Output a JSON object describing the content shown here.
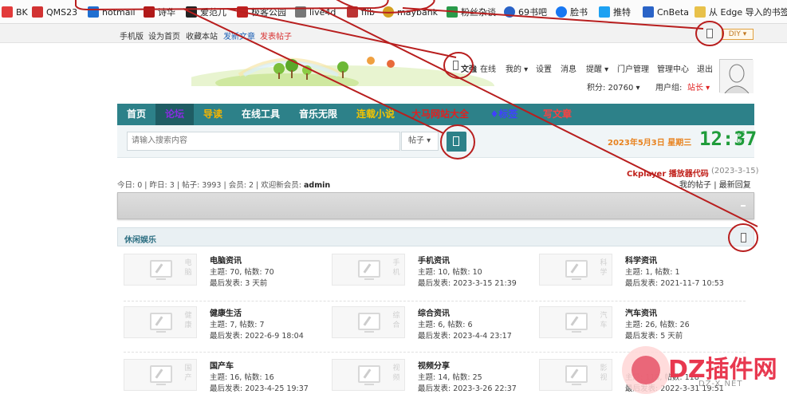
{
  "bookmarks": [
    {
      "label": "BK",
      "color": "#e23a3a"
    },
    {
      "label": "QMS23",
      "color": "#d23232"
    },
    {
      "label": "hotmail",
      "color": "#1f6fd1"
    },
    {
      "label": "诗华",
      "color": "#b01818"
    },
    {
      "label": "爱范儿",
      "color": "#222222"
    },
    {
      "label": "极客公园",
      "color": "#c02020"
    },
    {
      "label": "live4d",
      "color": "#777777"
    },
    {
      "label": "flib",
      "color": "#bb3333"
    },
    {
      "label": "maybank",
      "color": "#d4a020"
    },
    {
      "label": "粉丝杂谈",
      "color": "#2a9a4a"
    },
    {
      "label": "69书吧",
      "color": "#2a63c7"
    },
    {
      "label": "脸书",
      "color": "#1877f2"
    },
    {
      "label": "推特",
      "color": "#1da1f2"
    },
    {
      "label": "CnBeta",
      "color": "#2a63c7"
    },
    {
      "label": "从 Edge 导入的书签",
      "color": "#e8c14a"
    }
  ],
  "top_links": {
    "mobile": "手机版",
    "set_home": "设为首页",
    "favorite": "收藏本站",
    "new_post": "发新文章",
    "new_thread": "发表帖子",
    "diy": "DIY"
  },
  "user": {
    "name": "文強",
    "online": "在线",
    "mine": "我的",
    "settings": "设置",
    "messages": "消息",
    "remind": "提醒",
    "portal": "门户管理",
    "admin": "管理中心",
    "logout": "退出",
    "points_label": "积分: 20760",
    "group_label": "用户组:",
    "group": "站长"
  },
  "nav": [
    {
      "label": "首页",
      "color": "#ffffff"
    },
    {
      "label": "论坛",
      "color": "#8a2be2"
    },
    {
      "label": "导读",
      "color": "#f5b400"
    },
    {
      "label": "在线工具",
      "color": "#ffffff"
    },
    {
      "label": "音乐无限",
      "color": "#ffffff"
    },
    {
      "label": "连载小说",
      "color": "#f5c400"
    },
    {
      "label": "大马网站大全",
      "color": "#e02020"
    },
    {
      "label": "标签",
      "color": "#4040ff"
    },
    {
      "label": "写文章",
      "color": "#ff4040"
    }
  ],
  "search": {
    "placeholder": "请输入搜索内容",
    "type": "帖子"
  },
  "datetime": {
    "date": "2023年5月3日 星期三",
    "time": "12:37",
    "small_top": "08",
    "small_bottom": "07"
  },
  "stats": {
    "today_label": "今日:",
    "today": "0",
    "yesterday_label": "昨日:",
    "yesterday": "3",
    "posts_label": "帖子:",
    "posts": "3993",
    "members_label": "会员:",
    "members": "2",
    "welcome_label": "欢迎新会员:",
    "newest": "admin"
  },
  "notice": {
    "title": "Ckplayer 播放器代码",
    "date": "(2023-3-15)",
    "my_posts": "我的帖子",
    "latest": "最新回复"
  },
  "section": {
    "title": "休闲娱乐"
  },
  "forums": [
    {
      "name": "电脑资讯",
      "stats": "主题: 70, 帖数: 70",
      "last": "最后发表: 3 天前",
      "deco": "电脑"
    },
    {
      "name": "手机资讯",
      "stats": "主题: 10, 帖数: 10",
      "last": "最后发表: 2023-3-15 21:39",
      "deco": "手机"
    },
    {
      "name": "科学资讯",
      "stats": "主题: 1, 帖数: 1",
      "last": "最后发表: 2021-11-7 10:53",
      "deco": "科学"
    },
    {
      "name": "健康生活",
      "stats": "主题: 7, 帖数: 7",
      "last": "最后发表: 2022-6-9 18:04",
      "deco": "健康"
    },
    {
      "name": "综合资讯",
      "stats": "主题: 6, 帖数: 6",
      "last": "最后发表: 2023-4-4 23:17",
      "deco": "综合"
    },
    {
      "name": "汽车资讯",
      "stats": "主题: 26, 帖数: 26",
      "last": "最后发表: 5 天前",
      "deco": "汽车"
    },
    {
      "name": "国产车",
      "stats": "主题: 16, 帖数: 16",
      "last": "最后发表: 2023-4-25 19:37",
      "deco": "国产"
    },
    {
      "name": "视频分享",
      "stats": "主题: 14, 帖数: 25",
      "last": "最后发表: 2023-3-26 22:37",
      "deco": "视频"
    },
    {
      "name": "",
      "stats": "主题: 118, 帖数: 118",
      "last": "最后发表: 2022-3-31 19:51",
      "deco": "影视"
    }
  ],
  "watermark": {
    "text": "DZ插件网",
    "url": "DZ-X.NET"
  }
}
